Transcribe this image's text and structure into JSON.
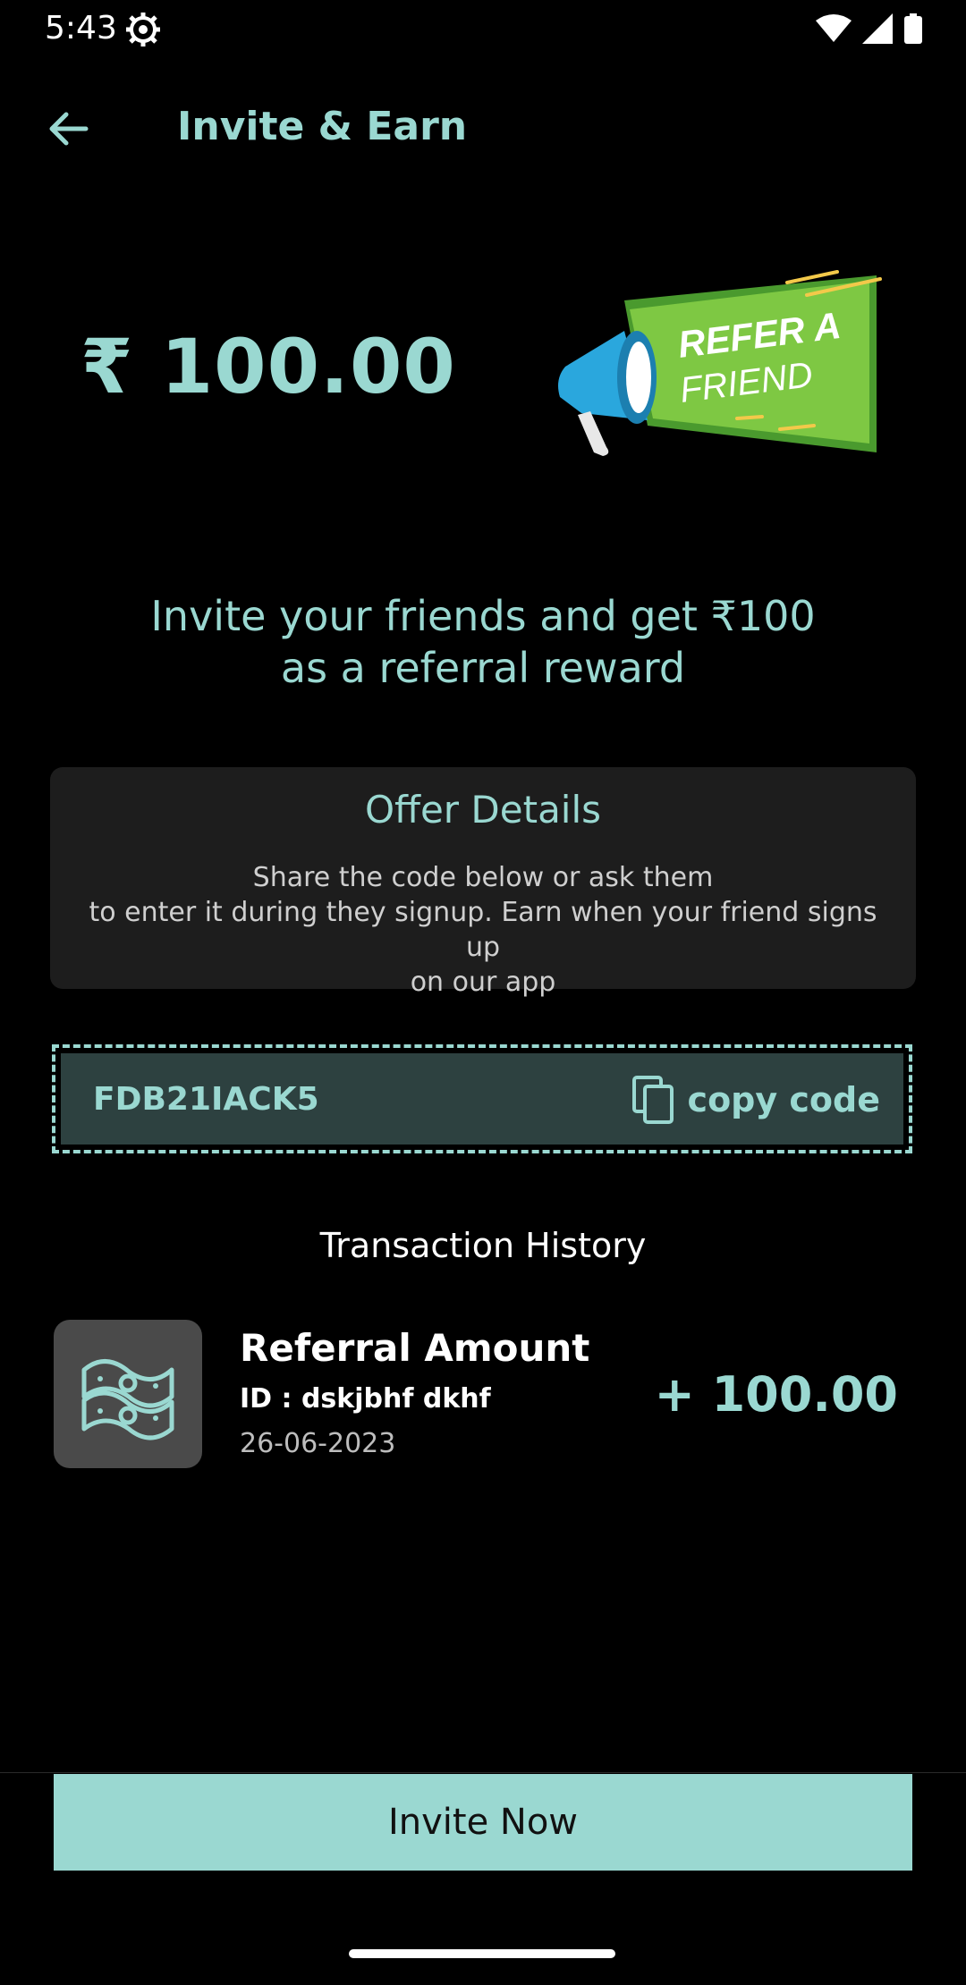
{
  "status_bar": {
    "time": "5:43",
    "icons": [
      "gear-icon",
      "wifi-icon",
      "signal-icon",
      "battery-icon"
    ]
  },
  "app_bar": {
    "back_icon": "arrow-left-icon",
    "title": "Invite & Earn"
  },
  "header": {
    "amount": "₹ 100.00",
    "banner_line1": "REFER A",
    "banner_line2": "FRIEND"
  },
  "invite_message": "Invite your friends and get ₹100\nas a referral reward",
  "offer": {
    "title": "Offer Details",
    "description": "Share the code below or ask them\nto enter it during they signup. Earn when your friend signs up\non our app"
  },
  "referral": {
    "code": "FDB21IACK5",
    "copy_label": "copy code",
    "copy_icon": "copy-icon"
  },
  "transactions": {
    "heading": "Transaction History",
    "items": [
      {
        "icon": "money-icon",
        "title": "Referral Amount",
        "id_text": "ID : dskjbhf dkhf",
        "date": "26-06-2023",
        "amount": "+ 100.00"
      }
    ]
  },
  "cta": {
    "label": "Invite Now"
  },
  "colors": {
    "accent": "#9ad8d1",
    "background": "#000000",
    "card": "#1d1d1d",
    "code_fill": "#2d4140",
    "thumb": "#4a4a4a"
  }
}
